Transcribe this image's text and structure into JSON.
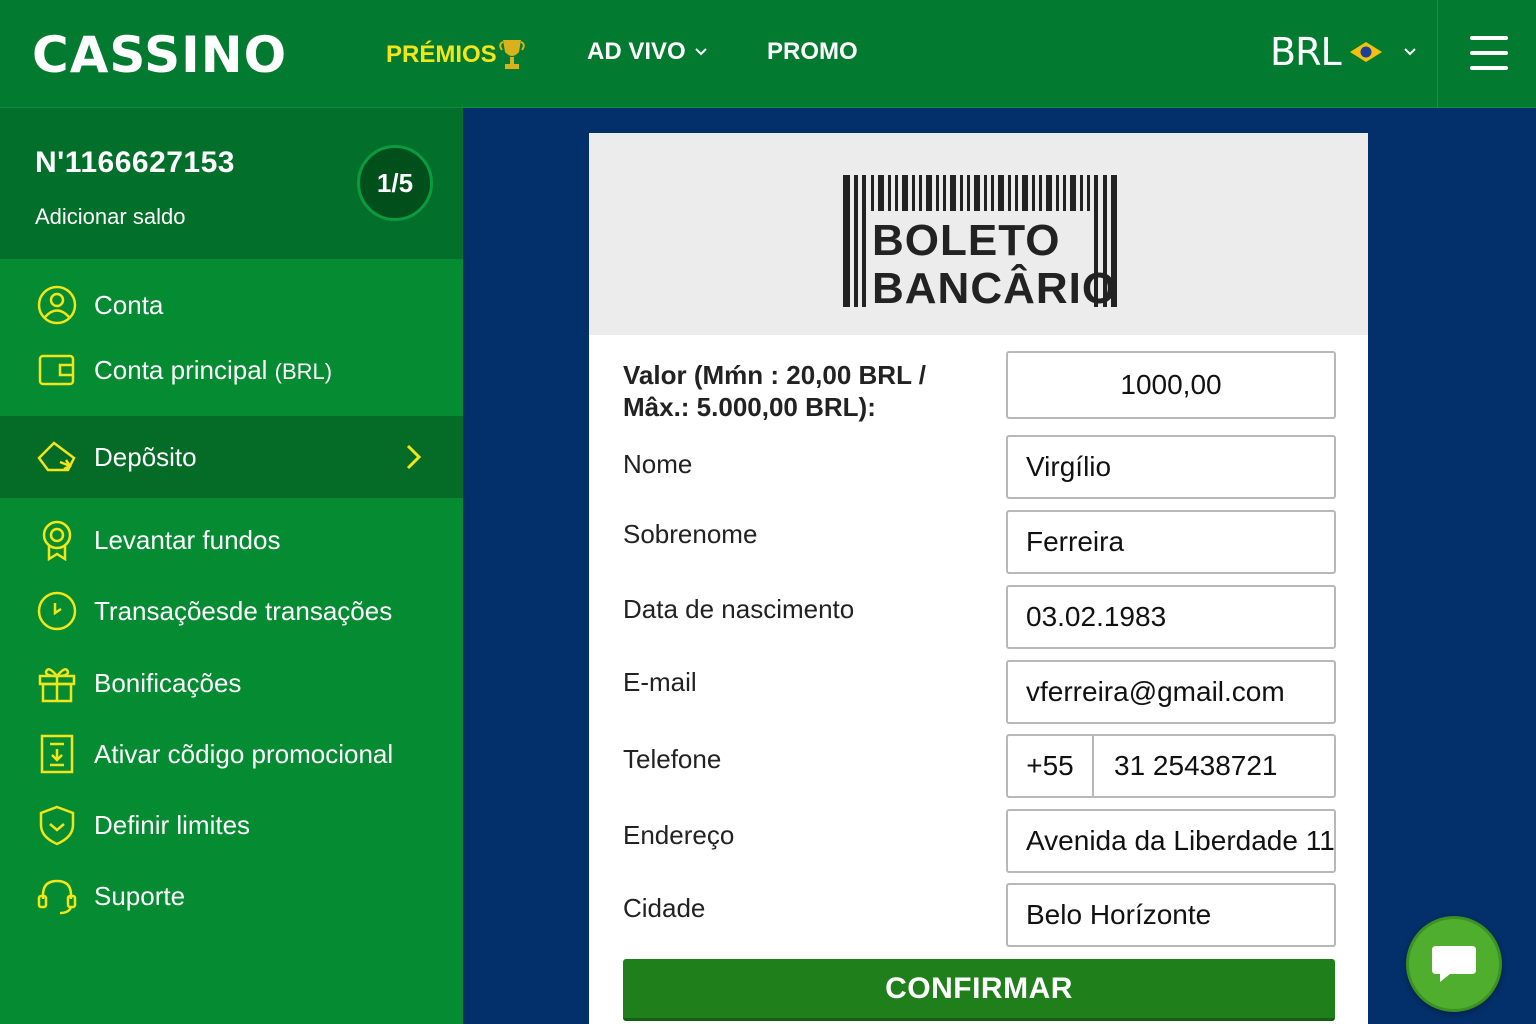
{
  "header": {
    "logo": "CASSINO",
    "nav": {
      "premios": "PRÉMIOS",
      "live": "AD VIVO",
      "promo": "PROMO"
    },
    "currency": "BRL",
    "colors": {
      "bar": "#027a30",
      "highlight": "#f2e61b"
    }
  },
  "sidebar": {
    "account_number": "N'1166627153",
    "add_balance": "Adicionar saldo",
    "level": "1/5",
    "items": [
      {
        "label": "Conta",
        "icon": "user-circle-icon"
      },
      {
        "label": "Conta principal",
        "sub": "(BRL)",
        "icon": "wallet-icon"
      },
      {
        "label": "Depõsito",
        "icon": "deposit-icon",
        "active": true
      },
      {
        "label": "Levantar fundos",
        "icon": "withdraw-icon"
      },
      {
        "label": "Transaçõesde transações",
        "icon": "history-icon"
      },
      {
        "label": "Bonificações",
        "icon": "gift-icon"
      },
      {
        "label": "Ativar cõdigo promocional",
        "icon": "promo-code-icon"
      },
      {
        "label": "Definir limites",
        "icon": "shield-icon"
      },
      {
        "label": "Suporte",
        "icon": "headset-icon"
      }
    ]
  },
  "form": {
    "provider_line1": "BOLETO",
    "provider_line2": "BANCÂRIO",
    "amount_label_line1": "Valor (Mḿn : 20,00 BRL /",
    "amount_label_line2": "Mâx.: 5.000,00 BRL):",
    "amount_value": "1000,00",
    "first_name_label": "Nome",
    "first_name_value": "Virgílio",
    "last_name_label": "Sobrenome",
    "last_name_value": "Ferreira",
    "birth_label": "Data de nascimento",
    "birth_value": "03.02.1983",
    "email_label": "E-mail",
    "email_value": "vferreira@gmail.com",
    "phone_label": "Telefone",
    "phone_code": "+55",
    "phone_value": "31 25438721",
    "address_label": "Endereço",
    "address_value": "Avenida da Liberdade 11",
    "city_label": "Cidade",
    "city_value": "Belo Horízonte",
    "confirm_label": "CONFIRMAR"
  }
}
